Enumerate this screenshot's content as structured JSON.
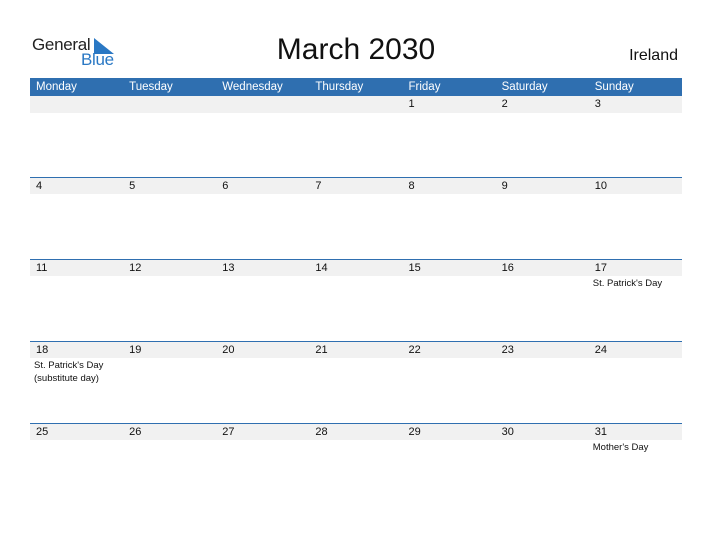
{
  "brand": {
    "general": "General",
    "blue": "Blue",
    "accent": "#2f6fb0"
  },
  "title": "March 2030",
  "country": "Ireland",
  "weekdays": [
    "Monday",
    "Tuesday",
    "Wednesday",
    "Thursday",
    "Friday",
    "Saturday",
    "Sunday"
  ],
  "weeks": [
    {
      "days": [
        "",
        "",
        "",
        "",
        "1",
        "2",
        "3"
      ],
      "events": [
        "",
        "",
        "",
        "",
        "",
        "",
        ""
      ]
    },
    {
      "days": [
        "4",
        "5",
        "6",
        "7",
        "8",
        "9",
        "10"
      ],
      "events": [
        "",
        "",
        "",
        "",
        "",
        "",
        ""
      ]
    },
    {
      "days": [
        "11",
        "12",
        "13",
        "14",
        "15",
        "16",
        "17"
      ],
      "events": [
        "",
        "",
        "",
        "",
        "",
        "",
        "St. Patrick's Day"
      ]
    },
    {
      "days": [
        "18",
        "19",
        "20",
        "21",
        "22",
        "23",
        "24"
      ],
      "events": [
        "St. Patrick's Day (substitute day)",
        "",
        "",
        "",
        "",
        "",
        ""
      ]
    },
    {
      "days": [
        "25",
        "26",
        "27",
        "28",
        "29",
        "30",
        "31"
      ],
      "events": [
        "",
        "",
        "",
        "",
        "",
        "",
        "Mother's Day"
      ]
    }
  ]
}
